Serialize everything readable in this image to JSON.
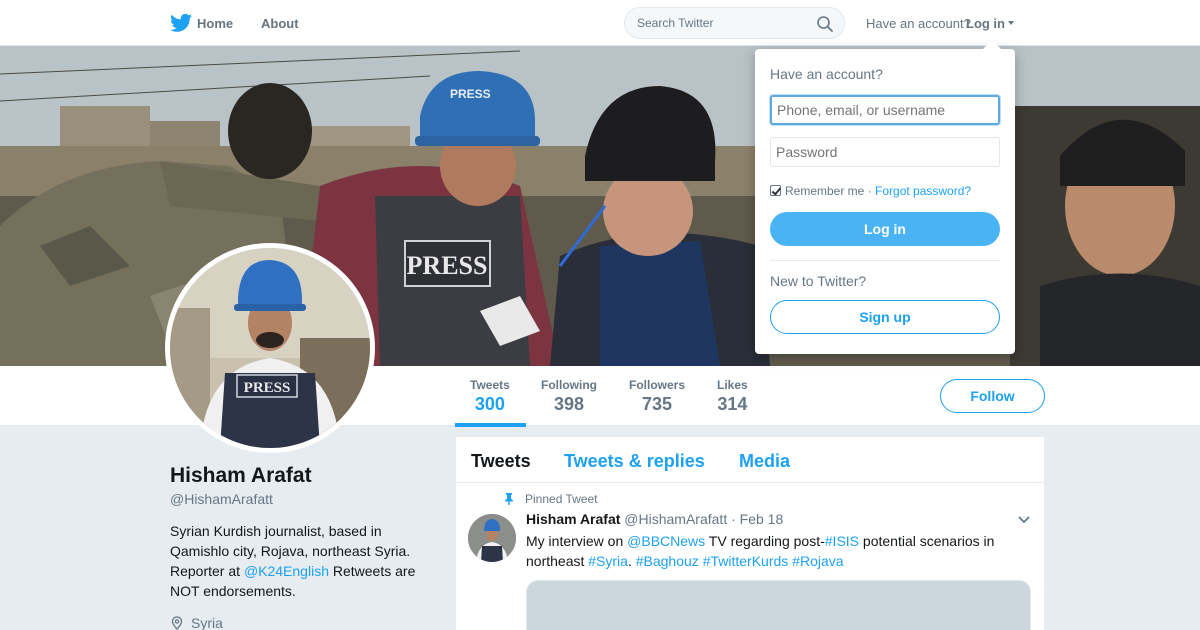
{
  "nav": {
    "home_label": "Home",
    "about_label": "About",
    "search_placeholder": "Search Twitter",
    "have_account_label": "Have an account?",
    "login_label": "Log in"
  },
  "banner": {
    "press_text": "PRESS",
    "helmet_text": "PRESS"
  },
  "profile": {
    "name": "Hisham Arafat",
    "handle": "@HishamArafatt",
    "bio_part1": "Syrian Kurdish journalist, based in Qamishlo city, Rojava, northeast Syria. Reporter at ",
    "bio_link": "@K24English",
    "bio_part2": " Retweets are NOT endorsements.",
    "location": "Syria",
    "avatar_press_text": "PRESS"
  },
  "stats": [
    {
      "label": "Tweets",
      "value": "300"
    },
    {
      "label": "Following",
      "value": "398"
    },
    {
      "label": "Followers",
      "value": "735"
    },
    {
      "label": "Likes",
      "value": "314"
    }
  ],
  "follow_label": "Follow",
  "timeline": {
    "tabs": [
      {
        "label": "Tweets"
      },
      {
        "label": "Tweets & replies"
      },
      {
        "label": "Media"
      }
    ],
    "pinned_label": "Pinned Tweet",
    "tweet": {
      "name": "Hisham Arafat",
      "handle": "@HishamArafatt",
      "dot": "·",
      "date": "Feb 18",
      "t1": "My interview on ",
      "l1": "@BBCNews",
      "t2": " TV regarding post-",
      "l2": "#ISIS",
      "t3": " potential scenarios in northeast ",
      "l3": "#Syria",
      "t4": ". ",
      "l4": "#Baghouz",
      "t5": " ",
      "l5": "#TwitterKurds",
      "t6": " ",
      "l6": "#Rojava"
    }
  },
  "login_dropdown": {
    "title": "Have an account?",
    "username_placeholder": "Phone, email, or username",
    "password_placeholder": "Password",
    "remember_label": "Remember me",
    "separator": " · ",
    "forgot_label": "Forgot password?",
    "login_button": "Log in",
    "new_label": "New to Twitter?",
    "signup_button": "Sign up"
  },
  "colors": {
    "accent": "#1da1f2",
    "login_button": "#4ab3f4",
    "background": "#e6ecf0",
    "muted_text": "#657786"
  }
}
